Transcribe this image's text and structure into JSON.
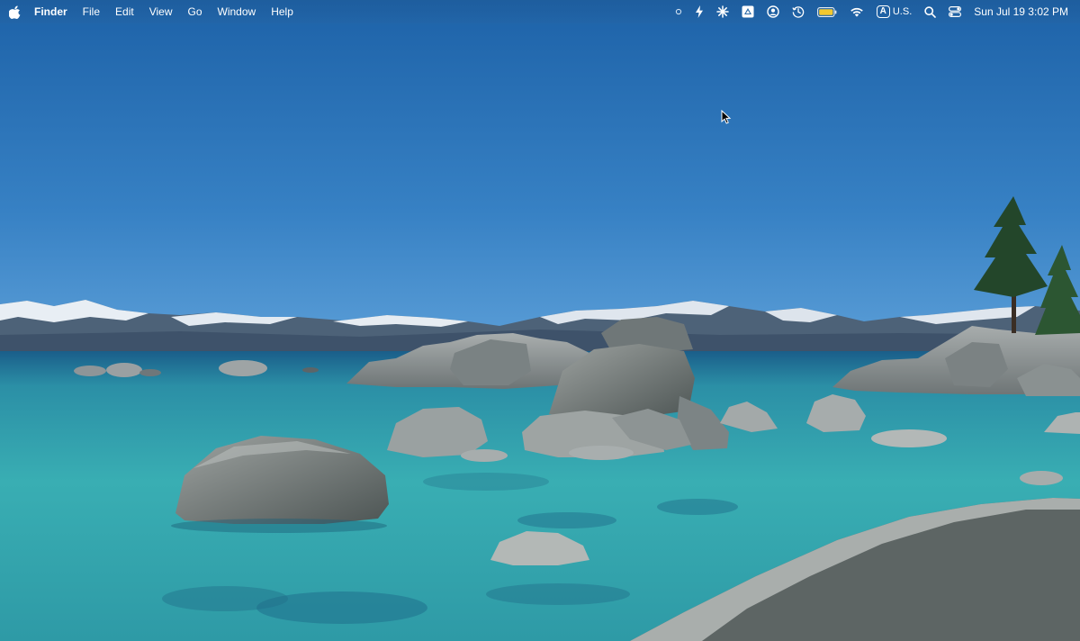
{
  "menubar": {
    "apple_icon": "apple-logo-icon",
    "app_name": "Finder",
    "menus": [
      "File",
      "Edit",
      "View",
      "Go",
      "Window",
      "Help"
    ],
    "status_icons": [
      "record-dot-icon",
      "bolt-icon",
      "asterisk-sparkle-icon",
      "google-drive-icon",
      "user-circle-icon",
      "time-machine-icon",
      "battery-icon",
      "wifi-icon"
    ],
    "input_source": {
      "badge": "A",
      "label": "U.S."
    },
    "right_icons": [
      "spotlight-search-icon",
      "control-center-icon"
    ],
    "clock": "Sun Jul 19  3:02 PM"
  },
  "desktop": {
    "wallpaper": "lake-tahoe-boulders-wallpaper",
    "colors": {
      "sky_top": "#1f66ad",
      "sky_bottom": "#4c94d6",
      "water": "#3fb3b7",
      "rock": "#8f9696"
    }
  }
}
